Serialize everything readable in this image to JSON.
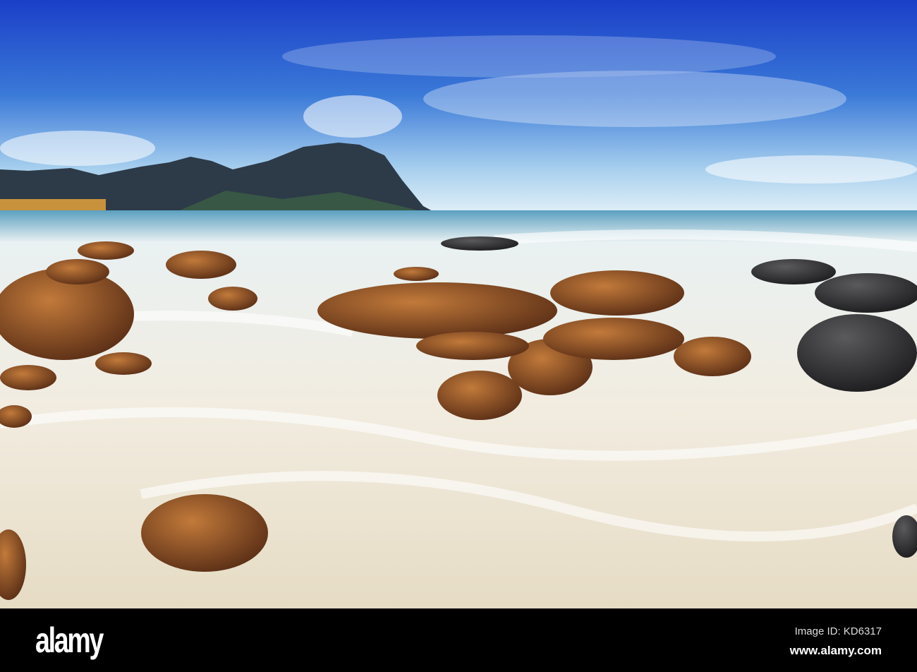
{
  "photo": {
    "subject": "beach-waves-rocks-mountains"
  },
  "watermark": {
    "text": "alamy"
  },
  "footer": {
    "logo": "alamy",
    "image_id": "Image ID: KD6317",
    "url": "www.alamy.com"
  },
  "colors": {
    "sky_top": "#1a3fc8",
    "sky_horizon": "#cfe6f5",
    "sea": "#4a8fb0",
    "foam": "#f3efe4",
    "rock": "#8a4a22",
    "dark_rock": "#3a3a3c",
    "mountain": "#2d3a48"
  }
}
